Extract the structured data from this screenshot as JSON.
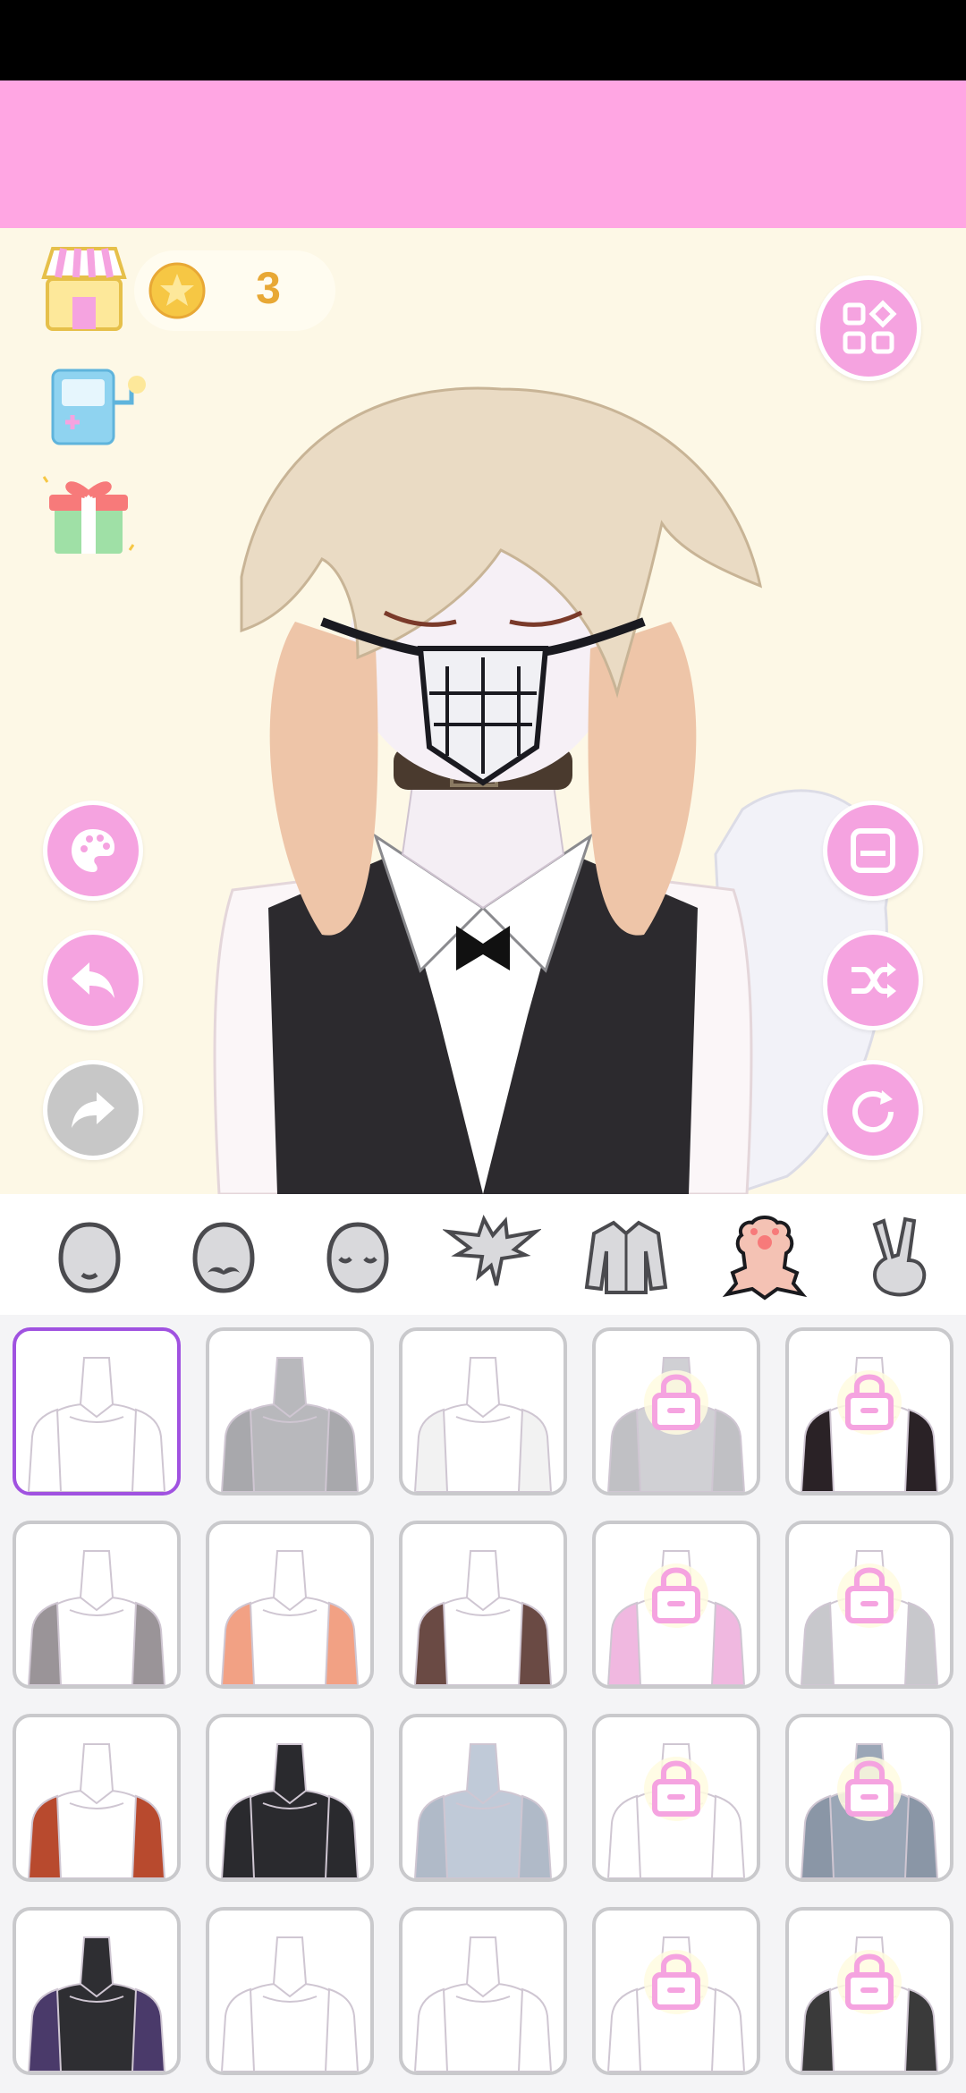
{
  "colors": {
    "banner": "#ffa6e3",
    "canvas_bg": "#fdf8e6",
    "accent_pink": "#f5a3e0",
    "disabled_gray": "#c7c7c7",
    "coin_text": "#e8a835",
    "selected_border": "#a052e0",
    "tile_border": "#c9c9cc"
  },
  "header": {
    "coins": "3",
    "shop_icon": "shop-icon",
    "coin_icon": "star-coin-icon",
    "gacha_icon": "gacha-machine-icon",
    "gift_icon": "gift-icon",
    "menu_icon": "grid-menu-icon"
  },
  "left_tools": [
    "palette-icon",
    "undo-icon",
    "redo-icon"
  ],
  "right_tools": [
    "save-icon",
    "shuffle-icon",
    "reset-icon"
  ],
  "category_tabs": [
    {
      "name": "face",
      "icon": "face-icon"
    },
    {
      "name": "mouth",
      "icon": "mustache-face-icon"
    },
    {
      "name": "eyes",
      "icon": "closed-eyes-face-icon"
    },
    {
      "name": "hair",
      "icon": "hair-icon"
    },
    {
      "name": "clothing",
      "icon": "shirt-icon"
    },
    {
      "name": "body",
      "icon": "body-icon",
      "active": true
    },
    {
      "name": "pose",
      "icon": "peace-hand-icon"
    }
  ],
  "body_items": [
    {
      "tone": "#ffffff",
      "arm": "#ffffff",
      "locked": false,
      "selected": true
    },
    {
      "tone": "#b8b8bc",
      "arm": "#a8a8ac",
      "locked": false
    },
    {
      "tone": "#ffffff",
      "arm": "#f2f2f2",
      "locked": false
    },
    {
      "tone": "#d0d0d4",
      "arm": "#c0c0c4",
      "locked": true
    },
    {
      "tone": "#ffffff",
      "arm": "#2a2226",
      "locked": true
    },
    {
      "tone": "#ffffff",
      "arm": "#9a9498",
      "locked": false
    },
    {
      "tone": "#ffffff",
      "arm": "#f2a184",
      "locked": false
    },
    {
      "tone": "#ffffff",
      "arm": "#6a4a44",
      "locked": false
    },
    {
      "tone": "#ffffff",
      "arm": "#f0b8e0",
      "locked": true
    },
    {
      "tone": "#ffffff",
      "arm": "#c8c8cc",
      "locked": true
    },
    {
      "tone": "#ffffff",
      "arm": "#b84a2e",
      "locked": false
    },
    {
      "tone": "#2a2a2e",
      "arm": "#2a2a2e",
      "locked": false
    },
    {
      "tone": "#c0cad8",
      "arm": "#b0bac8",
      "locked": false
    },
    {
      "tone": "#ffffff",
      "arm": "#ffffff",
      "locked": true
    },
    {
      "tone": "#9aa6b6",
      "arm": "#8a96a6",
      "locked": true
    },
    {
      "tone": "#2e2e32",
      "arm": "#4a3a6a",
      "locked": false
    },
    {
      "tone": "#ffffff",
      "arm": "#ffffff",
      "locked": false
    },
    {
      "tone": "#ffffff",
      "arm": "#ffffff",
      "locked": false
    },
    {
      "tone": "#ffffff",
      "arm": "#ffffff",
      "locked": true
    },
    {
      "tone": "#ffffff",
      "arm": "#3a3a3a",
      "locked": true
    }
  ]
}
